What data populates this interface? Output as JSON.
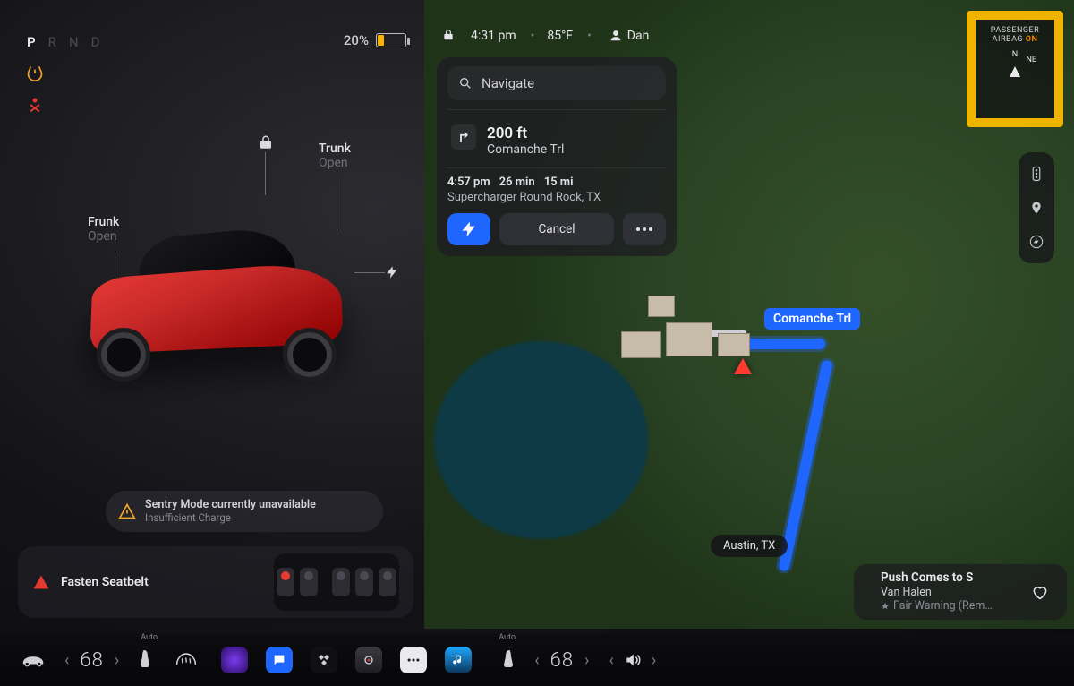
{
  "status": {
    "gears": [
      "P",
      "R",
      "N",
      "D"
    ],
    "selected_gear": "P",
    "battery_percent_text": "20%",
    "battery_percent": 20,
    "battery_color": "#f7b500"
  },
  "car_labels": {
    "frunk_title": "Frunk",
    "frunk_state": "Open",
    "trunk_title": "Trunk",
    "trunk_state": "Open"
  },
  "sentry": {
    "title": "Sentry Mode currently unavailable",
    "subtitle": "Insufficient Charge"
  },
  "seatbelt": {
    "label": "Fasten Seatbelt"
  },
  "map_status": {
    "time": "4:31 pm",
    "temp": "85°F",
    "user": "Dan"
  },
  "nav": {
    "search_placeholder": "Navigate",
    "step_distance": "200 ft",
    "step_street": "Comanche Trl",
    "eta_time": "4:57 pm",
    "eta_duration": "26 min",
    "eta_distance": "15 mi",
    "destination": "Supercharger Round Rock, TX",
    "cancel_label": "Cancel"
  },
  "airbag": {
    "line1": "PASSENGER",
    "line2": "AIRBAG",
    "state": "ON",
    "compass_n": "N",
    "compass_ne": "NE"
  },
  "map": {
    "road_label": "Comanche Trl",
    "city_pill": "Austin, TX"
  },
  "media": {
    "title": "Push Comes to S",
    "artist": "Van Halen",
    "album": "Fair Warning (Rem…"
  },
  "dock": {
    "driver_temp": "68",
    "passenger_temp": "68",
    "seat_auto": "Auto"
  },
  "colors": {
    "accent_blue": "#1f66ff",
    "warn_amber": "#f6a623",
    "warn_red": "#e43a2f",
    "highlight_yellow": "#f0b400",
    "car_red": "#d6302b"
  }
}
